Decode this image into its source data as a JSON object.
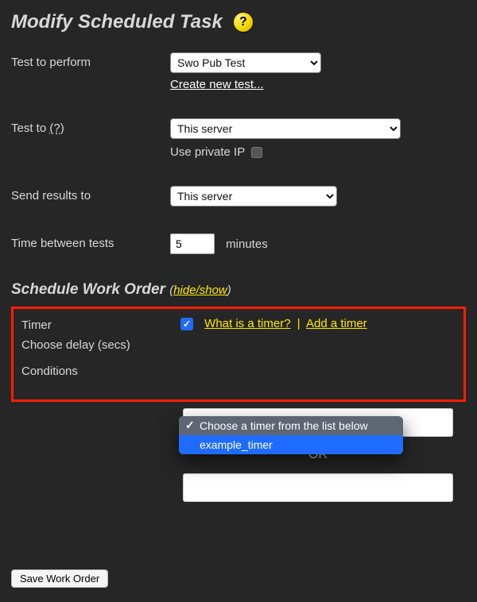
{
  "header": {
    "title": "Modify Scheduled Task",
    "help_tooltip": "?"
  },
  "form": {
    "test_to_perform": {
      "label": "Test to perform",
      "value": "Swo Pub Test",
      "create_link": "Create new test..."
    },
    "test_to": {
      "label": "Test to (?)",
      "value": "This server",
      "private_ip_label": "Use private IP",
      "private_ip_checked": false
    },
    "send_results_to": {
      "label": "Send results to",
      "value": "This server"
    },
    "time_between": {
      "label": "Time between tests",
      "value": "5",
      "units": "minutes"
    }
  },
  "schedule": {
    "heading": "Schedule Work Order",
    "hideshow": "hide/show",
    "timer": {
      "label": "Timer",
      "checked": true,
      "what_is": "What is a timer?",
      "add": "Add a timer",
      "sep": "|"
    },
    "choose_delay": {
      "label": "Choose delay (secs)",
      "option_header": "Choose a timer from the list below",
      "option_selected": "example_timer"
    },
    "conditions": {
      "label": "Conditions",
      "or": "OR"
    }
  },
  "footer": {
    "save": "Save Work Order"
  }
}
